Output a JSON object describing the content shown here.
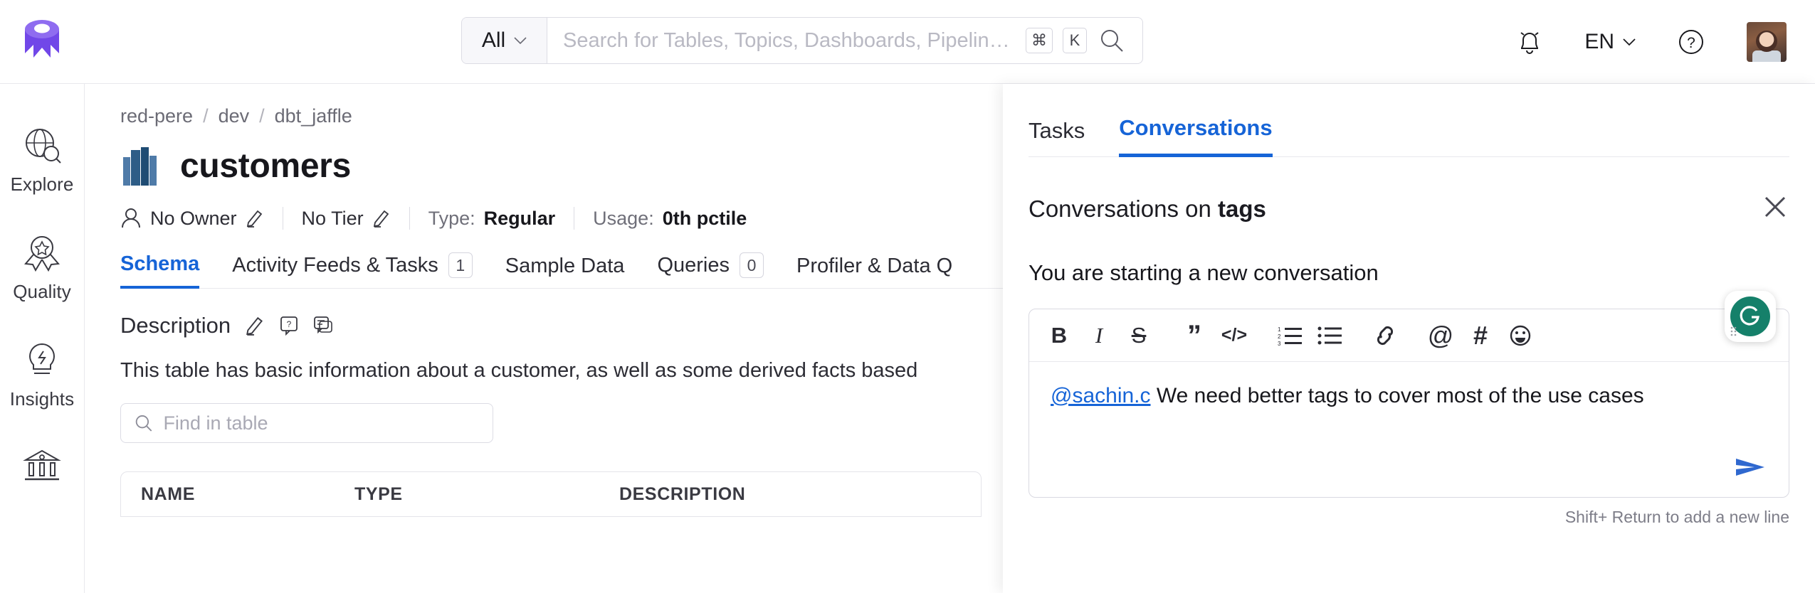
{
  "header": {
    "logo_name": "openmetadata-logo",
    "search": {
      "scope_label": "All",
      "placeholder": "Search for Tables, Topics, Dashboards, Pipelin…",
      "value": "",
      "kbd_meta": "⌘",
      "kbd_key": "K"
    },
    "notifications_icon": "bell-icon",
    "language": "EN",
    "help_icon": "help-circle-icon",
    "avatar_alt": "user-avatar"
  },
  "sidebar": {
    "items": [
      {
        "label": "Explore",
        "icon": "globe-search-icon"
      },
      {
        "label": "Quality",
        "icon": "award-ribbon-icon"
      },
      {
        "label": "Insights",
        "icon": "lightbulb-icon"
      },
      {
        "label": "",
        "icon": "governance-bank-icon"
      }
    ]
  },
  "main": {
    "breadcrumb": [
      "red-pere",
      "dev",
      "dbt_jaffle"
    ],
    "breadcrumb_separator": "/",
    "title": "customers",
    "title_icon": "table-bars-icon",
    "meta": {
      "owner": "No Owner",
      "tier": "No Tier",
      "type_label": "Type:",
      "type_value": "Regular",
      "usage_label": "Usage:",
      "usage_value": "0th pctile"
    },
    "tabs": [
      {
        "label": "Schema",
        "count": null,
        "active": true
      },
      {
        "label": "Activity Feeds & Tasks",
        "count": "1",
        "active": false
      },
      {
        "label": "Sample Data",
        "count": null,
        "active": false
      },
      {
        "label": "Queries",
        "count": "0",
        "active": false
      },
      {
        "label": "Profiler & Data Q",
        "count": null,
        "active": false
      }
    ],
    "description": {
      "heading": "Description",
      "text": "This table has basic information about a customer, as well as some derived facts based"
    },
    "find_placeholder": "Find in table",
    "find_value": "",
    "table_headers": [
      "NAME",
      "TYPE",
      "DESCRIPTION"
    ]
  },
  "right_panel": {
    "tabs": [
      {
        "label": "Tasks",
        "active": false
      },
      {
        "label": "Conversations",
        "active": true
      }
    ],
    "conversation_title_prefix": "Conversations on ",
    "conversation_title_target": "tags",
    "close_icon": "close-icon",
    "starting_text": "You are starting a new conversation",
    "toolbar": [
      {
        "name": "bold-icon",
        "glyph": "B"
      },
      {
        "name": "italic-icon",
        "glyph": "I"
      },
      {
        "name": "strikethrough-icon",
        "glyph": "S"
      },
      {
        "name": "blockquote-icon",
        "glyph": "”"
      },
      {
        "name": "code-icon",
        "glyph": "</>"
      },
      {
        "name": "ordered-list-icon",
        "glyph": ""
      },
      {
        "name": "bullet-list-icon",
        "glyph": ""
      },
      {
        "name": "link-icon",
        "glyph": ""
      },
      {
        "name": "mention-icon",
        "glyph": "@"
      },
      {
        "name": "hashtag-icon",
        "glyph": "#"
      },
      {
        "name": "emoji-icon",
        "glyph": ""
      }
    ],
    "message": {
      "mention": "@sachin.c",
      "text": " We need better tags to cover most of the use cases"
    },
    "send_icon": "send-icon",
    "hint": "Shift+ Return to add a new line",
    "grammarly_label": "G"
  },
  "colors": {
    "accent_blue": "#1664d7",
    "brand_purple": "#7147e8",
    "grammarly_green": "#15806a"
  }
}
